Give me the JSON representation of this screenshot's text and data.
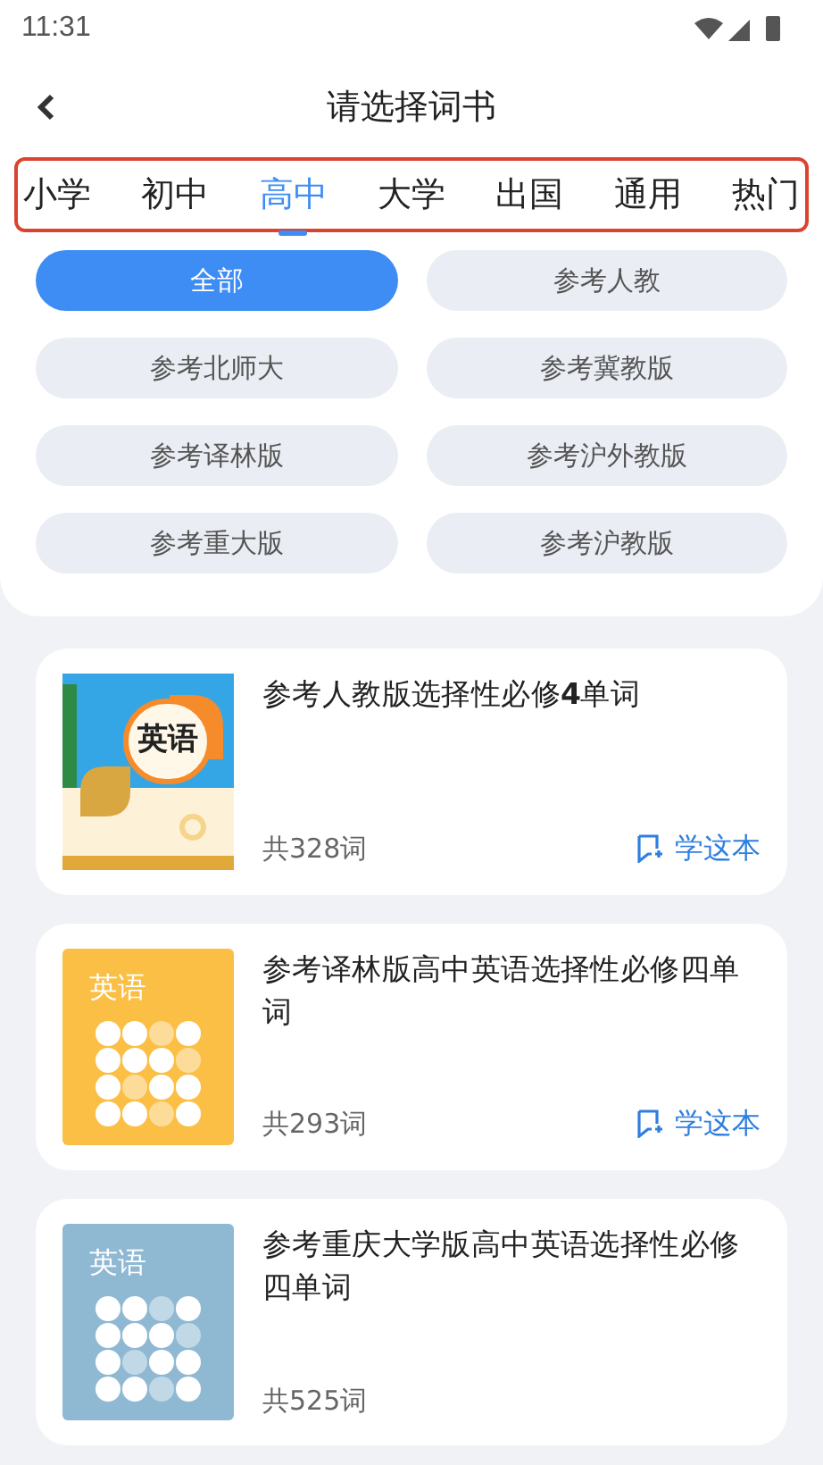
{
  "status_bar": {
    "time": "11:31"
  },
  "header": {
    "title": "请选择词书"
  },
  "tabs": [
    {
      "label": "小学",
      "selected": false
    },
    {
      "label": "初中",
      "selected": false
    },
    {
      "label": "高中",
      "selected": true
    },
    {
      "label": "大学",
      "selected": false
    },
    {
      "label": "出国",
      "selected": false
    },
    {
      "label": "通用",
      "selected": false
    },
    {
      "label": "热门",
      "selected": false
    }
  ],
  "filters": [
    {
      "label": "全部",
      "selected": true
    },
    {
      "label": "参考人教",
      "selected": false
    },
    {
      "label": "参考北师大",
      "selected": false
    },
    {
      "label": "参考冀教版",
      "selected": false
    },
    {
      "label": "参考译林版",
      "selected": false
    },
    {
      "label": "参考沪外教版",
      "selected": false
    },
    {
      "label": "参考重大版",
      "selected": false
    },
    {
      "label": "参考沪教版",
      "selected": false
    }
  ],
  "books": [
    {
      "cover": {
        "kind": "illustrated",
        "label": "英语"
      },
      "title": "参考人教版选择性必修**4**单词",
      "count": "共328词",
      "action": "学这本"
    },
    {
      "cover": {
        "kind": "dots",
        "label": "英语",
        "color": "#fbbf45"
      },
      "title": "参考译林版高中英语选择性必修四单词",
      "count": "共293词",
      "action": "学这本"
    },
    {
      "cover": {
        "kind": "dots",
        "label": "英语",
        "color": "#8fb8d3"
      },
      "title": "参考重庆大学版高中英语选择性必修四单词",
      "count": "共525词"
    }
  ]
}
